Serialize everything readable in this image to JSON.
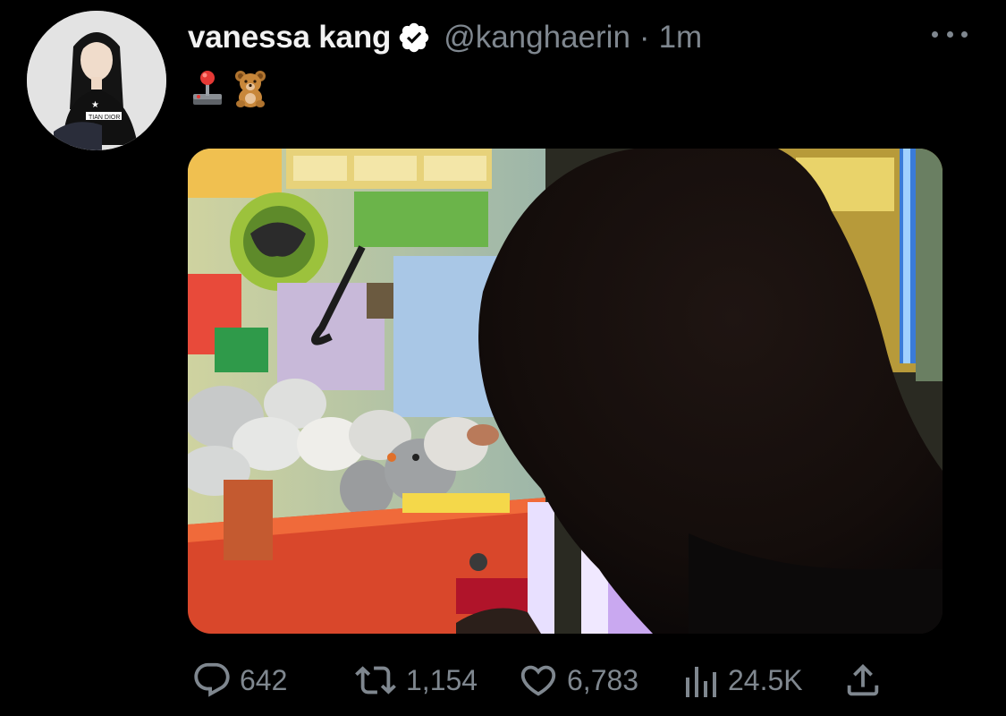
{
  "tweet": {
    "author": {
      "display_name": "vanessa kang",
      "verified": true,
      "handle": "@kanghaerin",
      "avatar_icon": "profile-avatar"
    },
    "separator": "·",
    "timestamp": "1m",
    "text_emojis": [
      "joystick-emoji",
      "teddy-bear-emoji"
    ],
    "media": {
      "type": "photo",
      "icon": "photo-claw-machine"
    },
    "more_icon": "more-horizontal-icon"
  },
  "actions": {
    "reply": {
      "icon": "reply-icon",
      "count": "642"
    },
    "retweet": {
      "icon": "retweet-icon",
      "count": "1,154"
    },
    "like": {
      "icon": "heart-icon",
      "count": "6,783"
    },
    "views": {
      "icon": "views-icon",
      "count": "24.5K"
    },
    "share": {
      "icon": "share-icon"
    }
  },
  "colors": {
    "background": "#000000",
    "name_text": "#f2f2f2",
    "secondary_text": "#7f878f",
    "verified_badge": "#ffffff"
  }
}
